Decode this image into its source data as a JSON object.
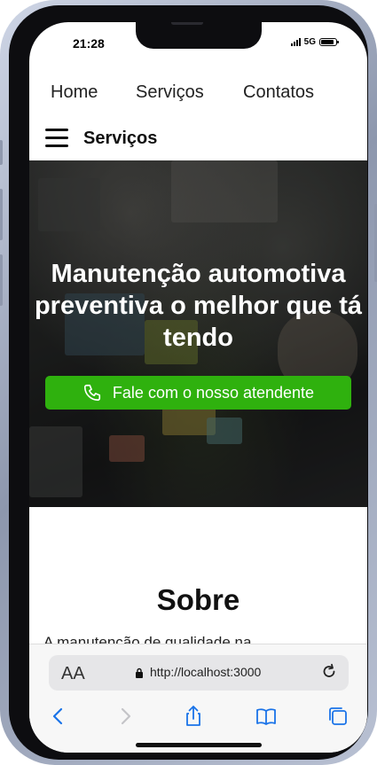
{
  "status": {
    "time": "21:28",
    "network": "5G",
    "battery_level": 0.9
  },
  "top_nav": {
    "items": [
      "Home",
      "Serviços",
      "Contatos"
    ]
  },
  "menu_bar": {
    "title": "Serviços"
  },
  "hero": {
    "title": "Manutenção automotiva preventiva o melhor que tá tendo",
    "cta_label": "Fale com o nosso atendente",
    "cta_color": "#2fb10e"
  },
  "about": {
    "title": "Sobre",
    "text": "A manutenção de qualidade na"
  },
  "browser": {
    "text_size_label": "AA",
    "url": "http://localhost:3000",
    "toolbar": [
      "back-icon",
      "forward-icon",
      "share-icon",
      "bookmarks-icon",
      "tabs-icon"
    ]
  }
}
